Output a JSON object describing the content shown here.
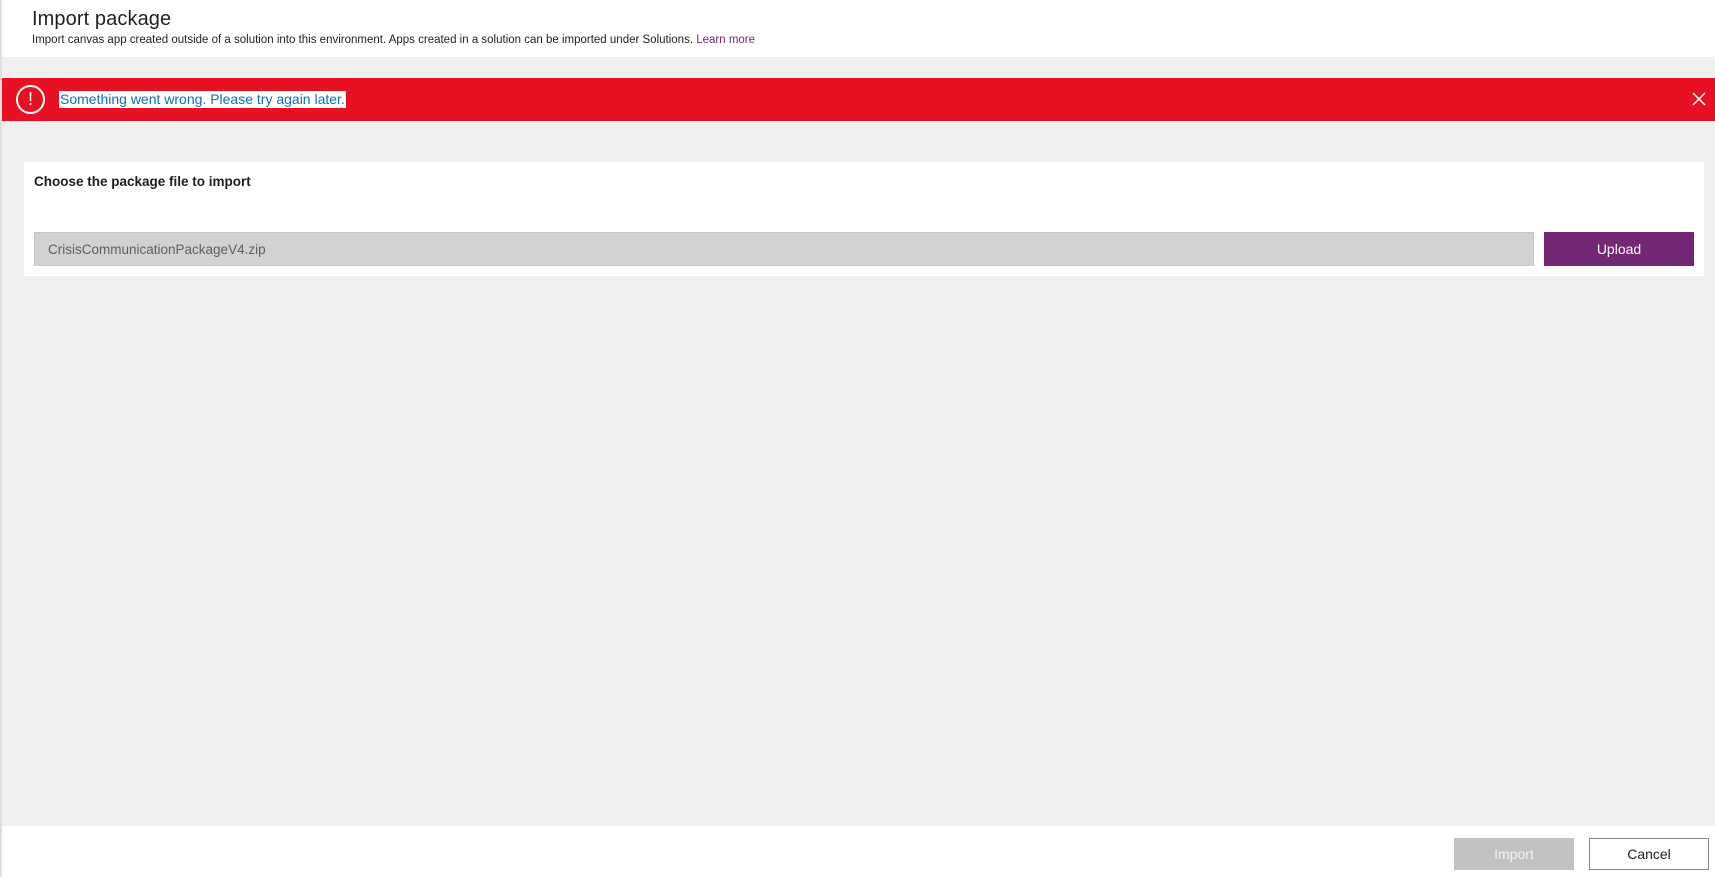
{
  "header": {
    "title": "Import package",
    "subtitle": "Import canvas app created outside of a solution into this environment. Apps created in a solution can be imported under Solutions.",
    "learn_more": "Learn more"
  },
  "error": {
    "icon": "error-circle-icon",
    "icon_glyph": "!",
    "message": "Something went wrong. Please try again later.",
    "close_icon": "close-icon",
    "color": "#e81123"
  },
  "package": {
    "label": "Choose the package file to import",
    "file_name": "CrisisCommunicationPackageV4.zip",
    "upload_label": "Upload",
    "accent": "#742774"
  },
  "footer": {
    "import_label": "Import",
    "cancel_label": "Cancel"
  }
}
